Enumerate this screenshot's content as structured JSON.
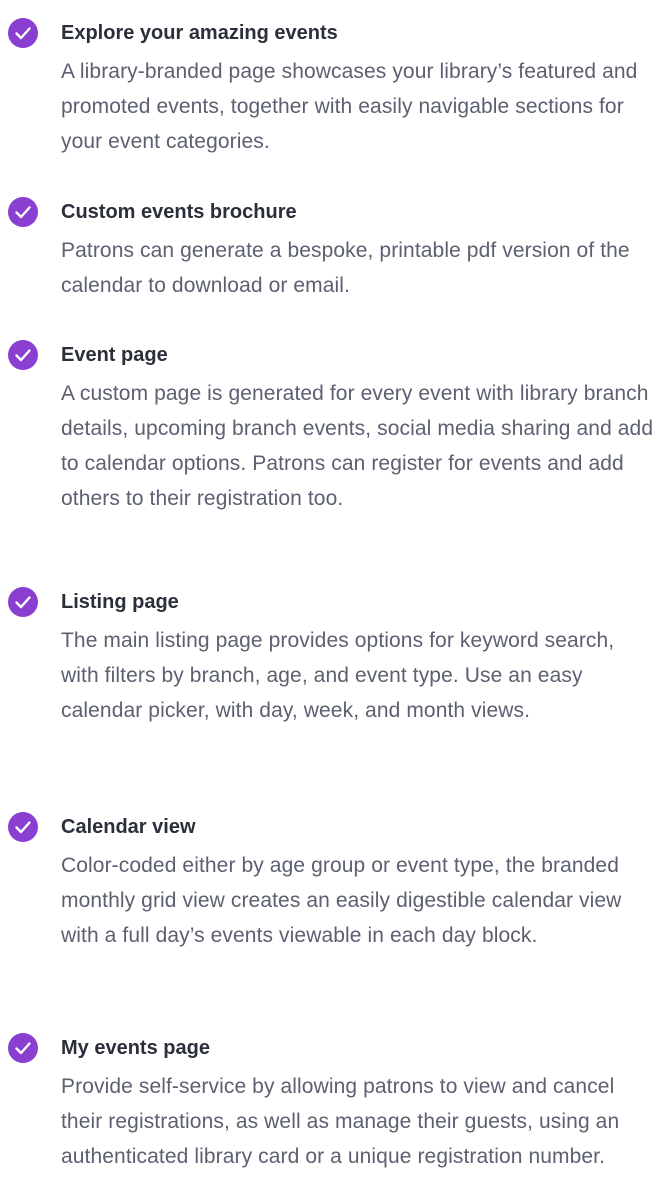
{
  "features": [
    {
      "title": "Explore your amazing events",
      "description": "A library-branded page showcases your library’s featured and promoted events, together with easily navigable sections for your event categories."
    },
    {
      "title": "Custom events brochure",
      "description": "Patrons can generate a bespoke, printable pdf version of the calendar to download or email."
    },
    {
      "title": "Event page",
      "description": "A custom page is generated for every event with library branch details, upcoming branch events, social media sharing and add to calendar options. Patrons can register for events and add others to their registration too."
    },
    {
      "title": "Listing page",
      "description": "The main listing page provides options for keyword search, with filters by branch, age, and event type. Use an easy calendar picker, with day, week, and month views."
    },
    {
      "title": "Calendar view",
      "description": "Color-coded either by age group or event type, the branded monthly grid view creates an easily digestible calendar view with a full day’s events viewable in each day block."
    },
    {
      "title": "My events page",
      "description": "Provide self-service by allowing patrons to view and cancel their registrations, as well as manage their guests, using an authenticated library card or a unique registration number."
    }
  ],
  "icons": {
    "check": "checkmark-circle-icon"
  },
  "colors": {
    "accent": "#8a3fd1",
    "title_text": "#2b2f3a",
    "body_text": "#5c6070"
  }
}
